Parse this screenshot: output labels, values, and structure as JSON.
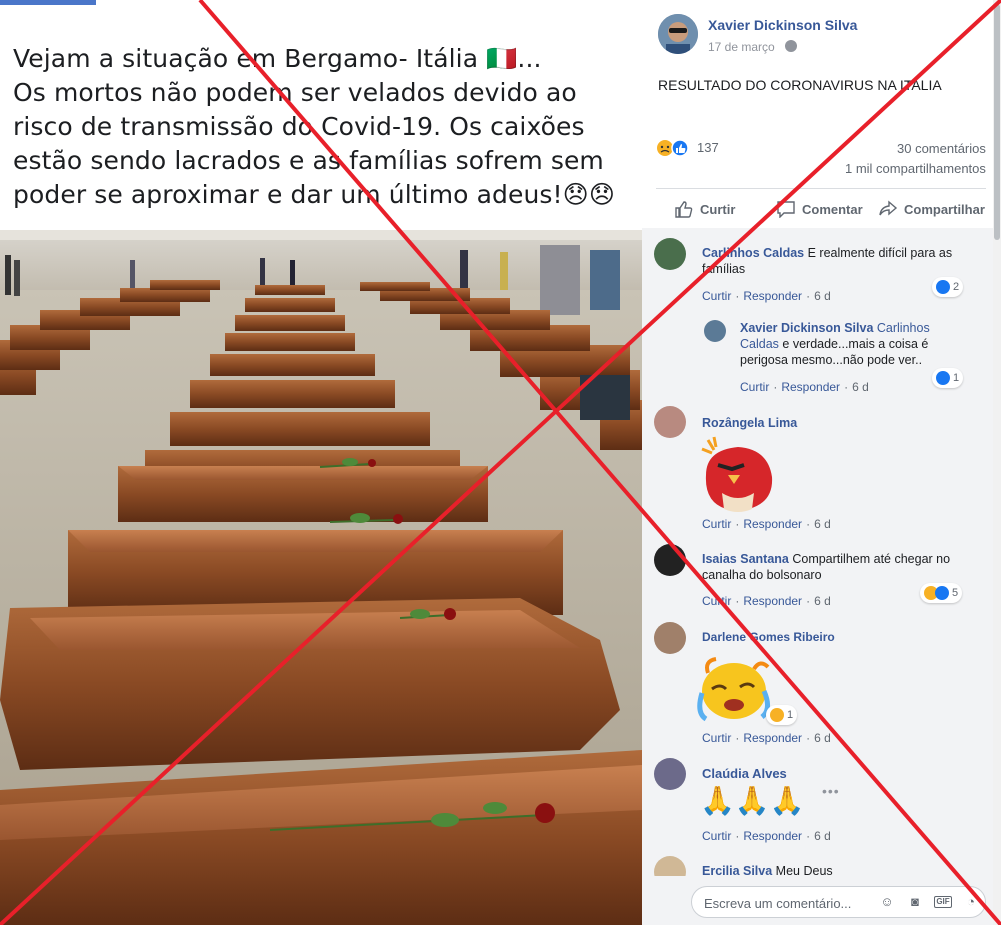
{
  "post": {
    "caption_lines": [
      "Vejam a situação em Bergamo- Itália 🇮🇹...",
      "Os mortos não podem ser velados devido ao",
      "risco de transmissão do Covid-19. Os caixões",
      "estão sendo lacrados e as famílias sofrem sem",
      "poder se aproximar e dar um último adeus!😞😞"
    ],
    "author": "Xavier Dickinson Silva",
    "time": "17 de março",
    "text": "RESULTADO DO CORONAVIRUS NA ITALIA",
    "reaction_count": "137",
    "comments": "30 comentários",
    "shares": "1 mil compartilhamentos",
    "actions": {
      "like": "Curtir",
      "comment": "Comentar",
      "share": "Compartilhar"
    }
  },
  "comments": [
    {
      "name": "Carlinhos Caldas",
      "text": "E realmente difícil para as famílias",
      "react_count": "2",
      "meta": {
        "like": "Curtir",
        "reply": "Responder",
        "time": "6 d"
      }
    },
    {
      "name": "Xavier Dickinson Silva",
      "mention": "Carlinhos Caldas",
      "text": "e verdade...mais a coisa é perigosa mesmo...não pode ver..",
      "react_count": "1",
      "meta": {
        "like": "Curtir",
        "reply": "Responder",
        "time": "6 d"
      }
    },
    {
      "name": "Rozângela Lima",
      "meta": {
        "like": "Curtir",
        "reply": "Responder",
        "time": "6 d"
      }
    },
    {
      "name": "Isaias Santana",
      "text": "Compartilhem até chegar no canalha do bolsonaro",
      "react_count": "5",
      "meta": {
        "like": "Curtir",
        "reply": "Responder",
        "time": "6 d"
      }
    },
    {
      "name": "Darlene Gomes Ribeiro",
      "react_count": "1",
      "meta": {
        "like": "Curtir",
        "reply": "Responder",
        "time": "6 d"
      }
    },
    {
      "name": "Claúdia Alves",
      "text": "🙏🙏🙏",
      "meta": {
        "like": "Curtir",
        "reply": "Responder",
        "time": "6 d"
      }
    },
    {
      "name": "Ercilia Silva",
      "text": "Meu Deus"
    }
  ],
  "write": {
    "placeholder": "Escreva um comentário..."
  },
  "colors": {
    "link": "#385898",
    "cross": "#e8202a",
    "like_blue": "#1877f2"
  }
}
